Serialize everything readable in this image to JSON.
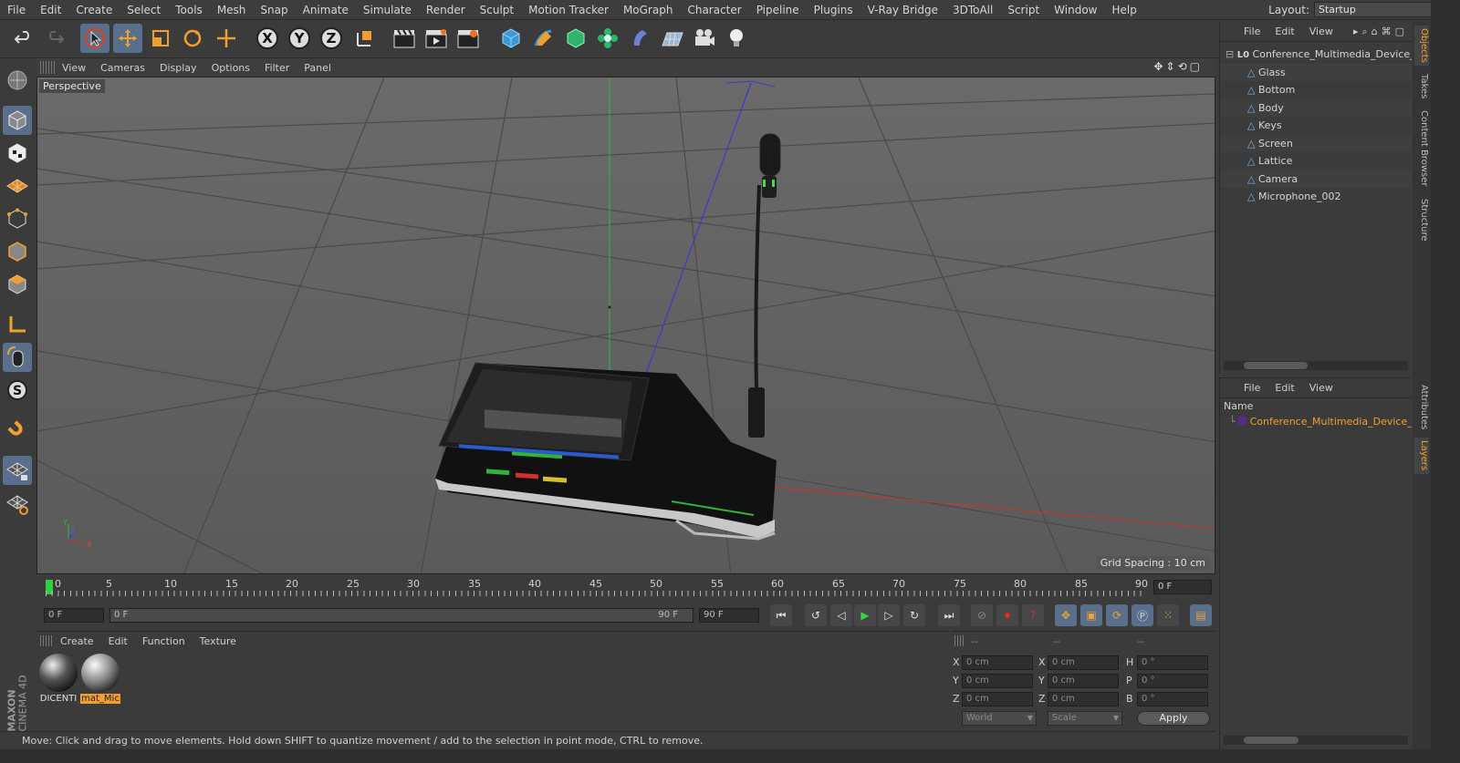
{
  "menubar": {
    "items": [
      "File",
      "Edit",
      "Create",
      "Select",
      "Tools",
      "Mesh",
      "Snap",
      "Animate",
      "Simulate",
      "Render",
      "Sculpt",
      "Motion Tracker",
      "MoGraph",
      "Character",
      "Pipeline",
      "Plugins",
      "V-Ray Bridge",
      "3DToAll",
      "Script",
      "Window",
      "Help"
    ],
    "layout_label": "Layout:",
    "layout_value": "Startup"
  },
  "toolbar": {
    "axis_x": "X",
    "axis_y": "Y",
    "axis_z": "Z"
  },
  "viewport": {
    "menu": [
      "View",
      "Cameras",
      "Display",
      "Options",
      "Filter",
      "Panel"
    ],
    "label": "Perspective",
    "grid_spacing": "Grid Spacing : 10 cm",
    "axis_y": "Y",
    "axis_z": "Z",
    "axis_x": "X"
  },
  "timeline": {
    "ticks": [
      "0",
      "5",
      "10",
      "15",
      "20",
      "25",
      "30",
      "35",
      "40",
      "45",
      "50",
      "55",
      "60",
      "65",
      "70",
      "75",
      "80",
      "85",
      "90"
    ],
    "current_frame": "0 F"
  },
  "transport": {
    "start_frame": "0 F",
    "range_start": "0 F",
    "range_end": "90 F",
    "end_frame": "90 F"
  },
  "materials": {
    "menu": [
      "Create",
      "Edit",
      "Function",
      "Texture"
    ],
    "items": [
      {
        "label": "DICENTI"
      },
      {
        "label": "mat_Mic"
      }
    ]
  },
  "coords": {
    "headers": [
      "--",
      "--",
      "--"
    ],
    "x_pos": "0 cm",
    "y_pos": "0 cm",
    "z_pos": "0 cm",
    "x_size": "0 cm",
    "y_size": "0 cm",
    "z_size": "0 cm",
    "h_rot": "0 °",
    "p_rot": "0 °",
    "b_rot": "0 °",
    "label_x": "X",
    "label_y": "Y",
    "label_z": "Z",
    "label_h": "H",
    "label_p": "P",
    "label_b": "B",
    "space": "World",
    "mode": "Scale",
    "apply": "Apply"
  },
  "status": {
    "text": "Move: Click and drag to move elements. Hold down SHIFT to quantize movement / add to the selection in point mode, CTRL to remove."
  },
  "brand": {
    "line1": "MAXON",
    "line2": "CINEMA 4D"
  },
  "objects": {
    "menu": [
      "File",
      "Edit",
      "View"
    ],
    "root": "Conference_Multimedia_Device_wi",
    "children": [
      "Glass",
      "Bottom",
      "Body",
      "Keys",
      "Screen",
      "Lattice",
      "Camera",
      "Microphone_002"
    ]
  },
  "layers": {
    "menu": [
      "File",
      "Edit",
      "View"
    ],
    "column": "Name",
    "item": "Conference_Multimedia_Device_w"
  },
  "sidetabs": [
    "Objects",
    "Takes",
    "Content Browser",
    "Structure",
    "Attributes",
    "Layers"
  ],
  "colors": {
    "accent": "#f0a030",
    "selection": "#5a6f8c",
    "viewport_bg": "#5e5e5e"
  }
}
